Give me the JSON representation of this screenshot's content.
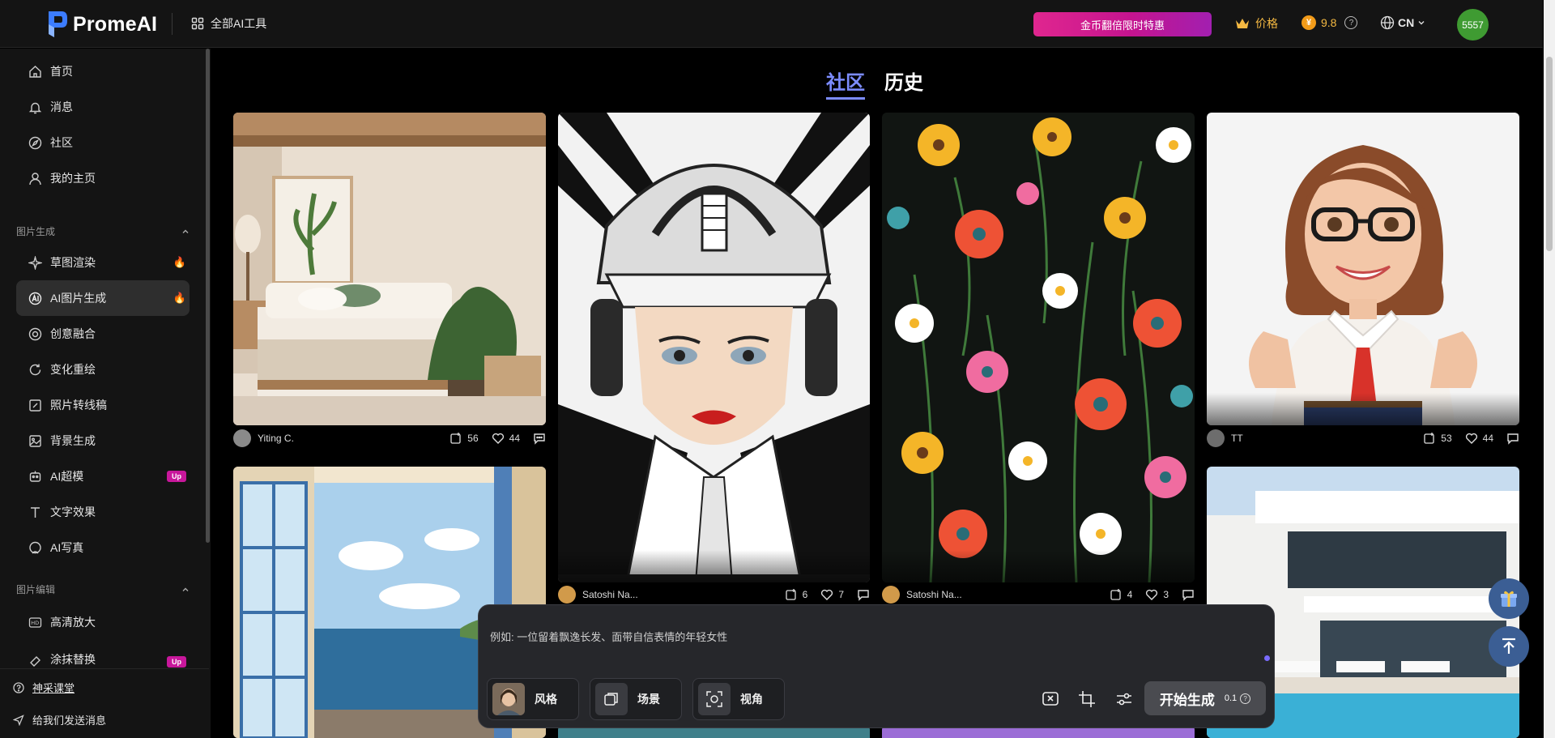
{
  "app": {
    "logo_text": "PromeAI"
  },
  "topbar": {
    "all_tools_label": "全部AI工具",
    "promo_label": "金币翻倍限时特惠",
    "price_label": "价格",
    "coin_balance": "9.8",
    "language": "CN",
    "user_avatar_text": "5557"
  },
  "sidebar": {
    "main_items": [
      {
        "label": "首页",
        "icon": "home-icon"
      },
      {
        "label": "消息",
        "icon": "bell-icon"
      },
      {
        "label": "社区",
        "icon": "compass-icon"
      },
      {
        "label": "我的主页",
        "icon": "user-icon"
      }
    ],
    "section_image_gen": "图片生成",
    "image_gen_items": [
      {
        "label": "草图渲染",
        "badge": "hot"
      },
      {
        "label": "AI图片生成",
        "badge": "hot",
        "active": true
      },
      {
        "label": "创意融合"
      },
      {
        "label": "变化重绘"
      },
      {
        "label": "照片转线稿"
      },
      {
        "label": "背景生成"
      },
      {
        "label": "AI超模",
        "badge": "Up"
      },
      {
        "label": "文字效果"
      },
      {
        "label": "AI写真"
      }
    ],
    "section_image_edit": "图片编辑",
    "image_edit_items": [
      {
        "label": "高清放大"
      },
      {
        "label": "涂抹替换",
        "badge": "Up"
      }
    ],
    "footer": {
      "course_label": "神采课堂",
      "feedback_label": "给我们发送消息"
    }
  },
  "main": {
    "tabs": [
      {
        "label": "社区",
        "active": true
      },
      {
        "label": "历史",
        "active": false
      }
    ],
    "cards": [
      {
        "author": "Yiting C.",
        "remix_count": "56",
        "like_count": "44",
        "subject": "bedroom interior"
      },
      {
        "author": "Satoshi Na...",
        "remix_count": "6",
        "like_count": "7",
        "subject": "woman in white helmet"
      },
      {
        "author": "Satoshi Na...",
        "remix_count": "4",
        "like_count": "3",
        "subject": "floral pattern"
      },
      {
        "author": "TT",
        "remix_count": "53",
        "like_count": "44",
        "subject": "3D cartoon woman"
      }
    ]
  },
  "prompt": {
    "placeholder": "例如: 一位留着飘逸长发、面带自信表情的年轻女性",
    "chips": [
      {
        "label": "风格"
      },
      {
        "label": "场景"
      },
      {
        "label": "视角"
      }
    ],
    "generate_label": "开始生成",
    "generate_cost": "0.1"
  },
  "colors": {
    "accent": "#7c8cff",
    "promo": "#e0268f",
    "gold": "#f5b942",
    "avatar": "#3f9b32"
  }
}
